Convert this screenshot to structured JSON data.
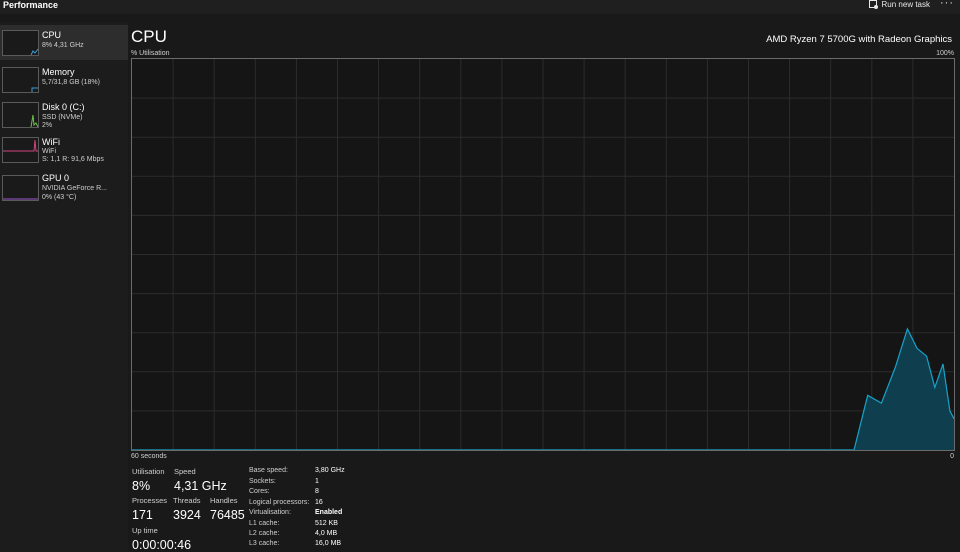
{
  "header": {
    "title": "Performance",
    "run_task_label": "Run new task",
    "more_label": "···"
  },
  "sidebar": {
    "items": [
      {
        "name": "CPU",
        "line1": "8% 4,31 GHz",
        "line2": "",
        "color": "#3b9fd8"
      },
      {
        "name": "Memory",
        "line1": "5,7/31,8 GB (18%)",
        "line2": "",
        "color": "#3b9fd8"
      },
      {
        "name": "Disk 0 (C:)",
        "line1": "SSD (NVMe)",
        "line2": "2%",
        "color": "#6cc24a"
      },
      {
        "name": "WiFi",
        "line1": "WiFi",
        "line2": "S: 1,1 R: 91,6 Mbps",
        "color": "#d1457e"
      },
      {
        "name": "GPU 0",
        "line1": "NVIDIA GeForce R...",
        "line2": "0% (43 °C)",
        "color": "#9b59d0"
      }
    ]
  },
  "main": {
    "title": "CPU",
    "model": "AMD Ryzen 7 5700G with Radeon Graphics",
    "util_axis_label": "% Utilisation",
    "max_label": "100%",
    "time_label": "60 seconds",
    "min_label": "0",
    "graph_color": "#17a2c9",
    "graph_fill": "#0f3f4e"
  },
  "chart_data": {
    "type": "area",
    "ylim": [
      0,
      100
    ],
    "grid": true,
    "series": [
      {
        "values": [
          {
            "t": 60,
            "v": 0
          },
          {
            "t": 7.3,
            "v": 0
          },
          {
            "t": 6.3,
            "v": 14
          },
          {
            "t": 5.3,
            "v": 12
          },
          {
            "t": 4.3,
            "v": 21
          },
          {
            "t": 3.4,
            "v": 31
          },
          {
            "t": 2.7,
            "v": 26
          },
          {
            "t": 2.0,
            "v": 24
          },
          {
            "t": 1.4,
            "v": 16
          },
          {
            "t": 0.8,
            "v": 22
          },
          {
            "t": 0.3,
            "v": 10
          },
          {
            "t": 0,
            "v": 8
          }
        ]
      }
    ]
  },
  "stats": {
    "utilisation_label": "Utilisation",
    "utilisation_value": "8%",
    "speed_label": "Speed",
    "speed_value": "4,31 GHz",
    "processes_label": "Processes",
    "processes_value": "171",
    "threads_label": "Threads",
    "threads_value": "3924",
    "handles_label": "Handles",
    "handles_value": "76485",
    "uptime_label": "Up time",
    "uptime_value": "0:00:00:46"
  },
  "specs": [
    {
      "label": "Base speed:",
      "value": "3,80 GHz",
      "bold": false
    },
    {
      "label": "Sockets:",
      "value": "1",
      "bold": false
    },
    {
      "label": "Cores:",
      "value": "8",
      "bold": false
    },
    {
      "label": "Logical processors:",
      "value": "16",
      "bold": false
    },
    {
      "label": "Virtualisation:",
      "value": "Enabled",
      "bold": true
    },
    {
      "label": "L1 cache:",
      "value": "512 KB",
      "bold": false
    },
    {
      "label": "L2 cache:",
      "value": "4,0 MB",
      "bold": false
    },
    {
      "label": "L3 cache:",
      "value": "16,0 MB",
      "bold": false
    }
  ]
}
